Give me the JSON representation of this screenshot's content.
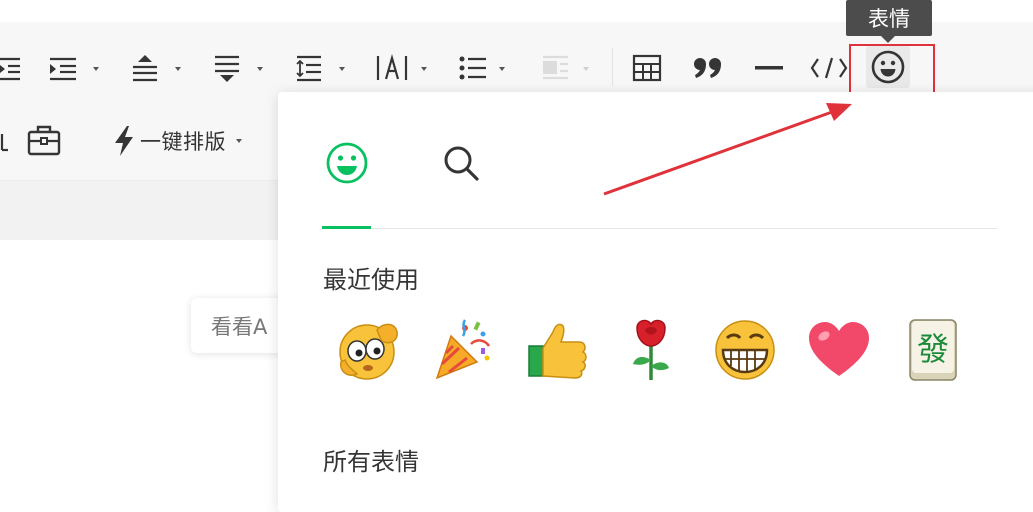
{
  "toolbar": {
    "typeset_label": "一键排版",
    "code_icon_text": "</>",
    "accent_red": "#e0323a"
  },
  "tooltip": {
    "text": "表情"
  },
  "editor": {
    "placeholder_partial": "看看A"
  },
  "emoji_panel": {
    "accent_color": "#07c160",
    "tabs": [
      "emoji-tab",
      "search-tab"
    ],
    "recent_title": "最近使用",
    "all_title": "所有表情",
    "recent_emojis": [
      "salute",
      "party-popper",
      "thumbs-up",
      "rose",
      "grin",
      "heart",
      "mahjong-fa"
    ],
    "mahjong_char": "發"
  }
}
